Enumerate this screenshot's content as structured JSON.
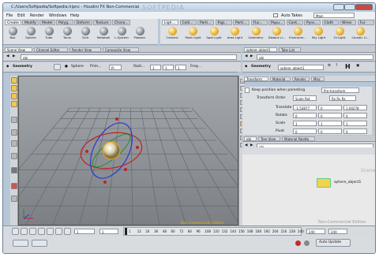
{
  "window": {
    "title": "C:/Users/Softpedia/Softpedia.hipnc - Houdini FX Non-Commercial",
    "watermark": "SOFTPEDIA",
    "auto_takes_label": "Auto Takes",
    "main_label": "Main"
  },
  "menu": [
    "File",
    "Edit",
    "Render",
    "Windows",
    "Help"
  ],
  "shelf_left": {
    "tabs": [
      "Create",
      "Modify",
      "Model",
      "Polyg...",
      "Deform",
      "Texture",
      "Chara..."
    ],
    "tools": [
      {
        "label": "Box",
        "icon": "box-icon"
      },
      {
        "label": "Sphere",
        "icon": "sphere-icon"
      },
      {
        "label": "Tube",
        "icon": "tube-icon"
      },
      {
        "label": "Torus",
        "icon": "torus-icon"
      },
      {
        "label": "Grid",
        "icon": "grid-icon"
      },
      {
        "label": "Metaball",
        "icon": "metaball-icon"
      },
      {
        "label": "L-System",
        "icon": "lsystem-icon"
      },
      {
        "label": "Platonic",
        "icon": "platonic-icon"
      }
    ]
  },
  "shelf_right": {
    "tabs": [
      "Ligh...",
      "Colli...",
      "Parti...",
      "Rigi...",
      "Parti...",
      "Flui...",
      "Popu...",
      "Cont...",
      "Pyro...",
      "Cloth",
      "Wires",
      "Fur"
    ],
    "tools": [
      {
        "label": "Camera",
        "icon": "camera-icon"
      },
      {
        "label": "Point Light",
        "icon": "point-light-icon"
      },
      {
        "label": "Spot Light",
        "icon": "spot-light-icon"
      },
      {
        "label": "Area Light",
        "icon": "area-light-icon"
      },
      {
        "label": "Geometry",
        "icon": "geometry-light-icon"
      },
      {
        "label": "Distant Li...",
        "icon": "distant-light-icon"
      },
      {
        "label": "Environm...",
        "icon": "environment-light-icon"
      },
      {
        "label": "Sky Light",
        "icon": "sky-light-icon"
      },
      {
        "label": "GI Light",
        "icon": "gi-light-icon"
      },
      {
        "label": "Caustic Li...",
        "icon": "caustic-light-icon"
      }
    ]
  },
  "viewer_tabs": [
    "Scene View",
    "Channel Editor",
    "Render View",
    "Composite View"
  ],
  "viewer_path": "obj",
  "viewer_toolbar": {
    "mode": "Geometry",
    "object": "Sphere",
    "prim_label": "Prim...",
    "prim_value": "Pr",
    "radius_label": "Radi...",
    "radius_values": [
      "1",
      "1",
      "1"
    ],
    "freq_label": "Freq..."
  },
  "viewport": {
    "watermark": "Non-Commercial Edition"
  },
  "params_tabs": [
    "sphere_object1",
    "Tabs List"
  ],
  "params_path": "obj",
  "params_header": {
    "mode": "Geometry",
    "name": "sphere_object1",
    "h_label": "H"
  },
  "params_subtabs": [
    "Transform",
    "Material",
    "Render",
    "Misc"
  ],
  "params": {
    "keep_position": "Keep position when parenting",
    "keep_value": "Pre-transform",
    "transform_order_label": "Transform Order",
    "transform_order_value": "Scale Rot",
    "rot_order_value": "Rx Ry Rz",
    "rows": [
      {
        "label": "Translate",
        "values": [
          "-1.53877",
          "0",
          "1.04278"
        ]
      },
      {
        "label": "Rotate",
        "values": [
          "0",
          "0",
          "0"
        ]
      },
      {
        "label": "Scale",
        "values": [
          "1",
          "1",
          "1"
        ]
      },
      {
        "label": "Pivot",
        "values": [
          "0",
          "0",
          "0"
        ]
      }
    ]
  },
  "net_tabs": [
    "obj",
    "Tree View",
    "Material Palette"
  ],
  "net_path": "obj",
  "network": {
    "scene_label": "Scene",
    "node_name": "sphere_object1",
    "watermark": "Non-Commercial Edition"
  },
  "timeline": {
    "start": "1",
    "current": "1",
    "end": "240",
    "end2": "240",
    "ticks": [
      "1",
      "12",
      "24",
      "36",
      "48",
      "60",
      "72",
      "84",
      "96",
      "108",
      "120",
      "132",
      "144",
      "156",
      "168",
      "180",
      "192",
      "204",
      "216",
      "228",
      "240"
    ]
  },
  "status": {
    "auto_update": "Auto Update"
  },
  "colors": {
    "accent": "#f0a400",
    "viewport_top": "#a4a9ae",
    "viewport_bottom": "#7c8085"
  }
}
